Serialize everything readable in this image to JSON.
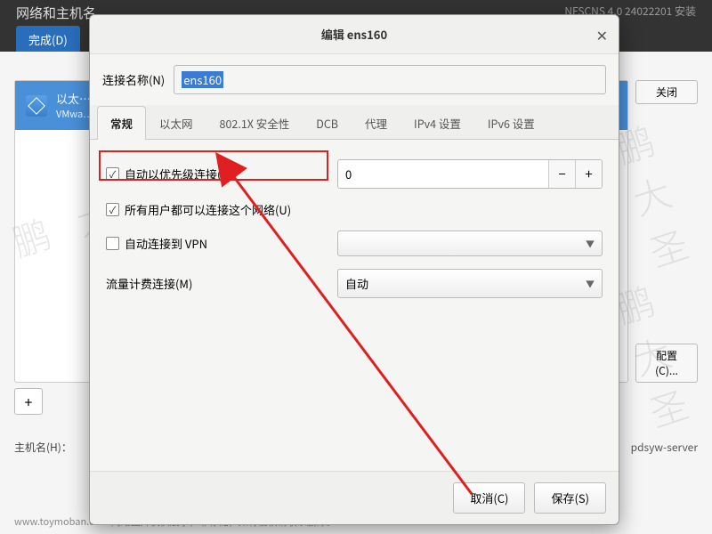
{
  "bg": {
    "title": "网络和主机名",
    "right_text": "NFSCNS 4.0 24022201 安装",
    "done_btn": "完成(D)",
    "conn_title": "以太…",
    "conn_sub": "VMwa…",
    "close_btn": "关闭",
    "config_btn": "配置(C)...",
    "plus": "+",
    "host_label": "主机名(H)：",
    "host_value": "pdsyw-server",
    "footer": "www.toymoban.com 网络图片仅供展示，非存储，如有侵权请联系删除。"
  },
  "dialog": {
    "title": "编辑 ens160",
    "name_label": "连接名称(N)",
    "name_value": "ens160",
    "tabs": [
      "常规",
      "以太网",
      "802.1X 安全性",
      "DCB",
      "代理",
      "IPv4 设置",
      "IPv6 设置"
    ],
    "active_tab": 0,
    "form": {
      "auto_priority_label": "自动以优先级连接(A)",
      "auto_priority_checked": true,
      "priority_value": "0",
      "all_users_label": "所有用户都可以连接这个网络(U)",
      "all_users_checked": true,
      "auto_vpn_label": "自动连接到 VPN",
      "auto_vpn_checked": false,
      "vpn_combo": "",
      "metered_label": "流量计费连接(M)",
      "metered_value": "自动"
    },
    "cancel": "取消(C)",
    "save": "保存(S)"
  },
  "watermark": "鹏 大 圣"
}
